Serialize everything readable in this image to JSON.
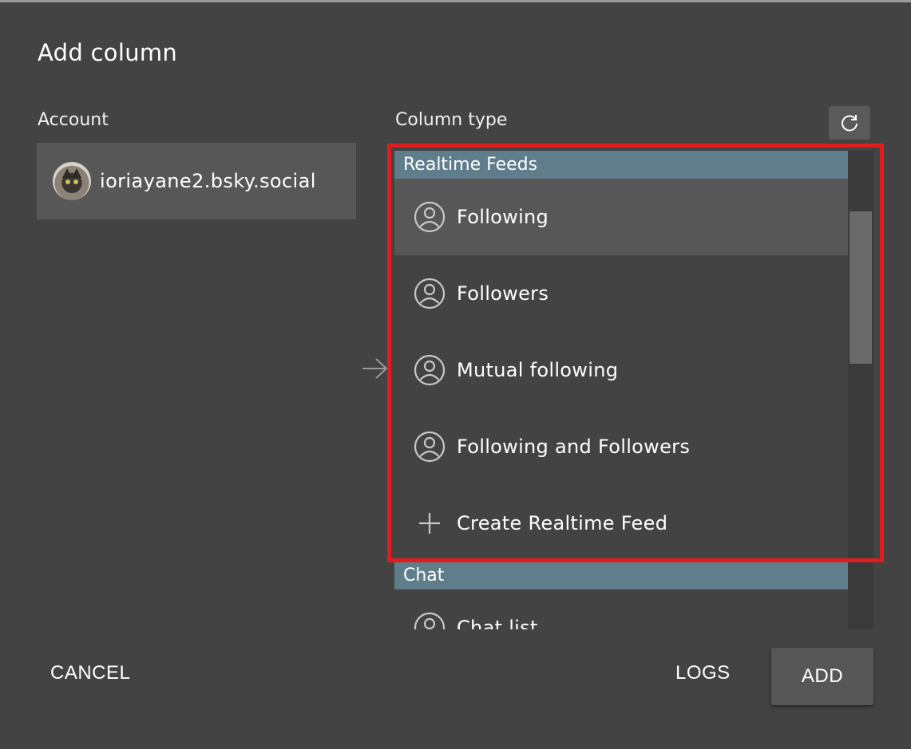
{
  "dialog": {
    "title": "Add column",
    "account_label": "Account",
    "column_type_label": "Column type"
  },
  "account": {
    "name": "ioriayane2.bsky.social"
  },
  "icons": {
    "refresh": "refresh-icon",
    "arrow": "arrow-right-icon",
    "user": "user-circle-icon",
    "plus": "plus-icon"
  },
  "column_types": {
    "groups": [
      {
        "header": "Realtime Feeds",
        "items": [
          {
            "label": "Following",
            "icon": "user-circle-icon",
            "selected": true
          },
          {
            "label": "Followers",
            "icon": "user-circle-icon"
          },
          {
            "label": "Mutual following",
            "icon": "user-circle-icon"
          },
          {
            "label": "Following and Followers",
            "icon": "user-circle-icon"
          },
          {
            "label": "Create Realtime Feed",
            "icon": "plus-icon"
          }
        ]
      },
      {
        "header": "Chat",
        "items": [
          {
            "label": "Chat list",
            "icon": "user-circle-icon"
          }
        ]
      }
    ]
  },
  "footer": {
    "cancel_label": "CANCEL",
    "logs_label": "LOGS",
    "add_label": "ADD"
  },
  "colors": {
    "background": "#434343",
    "group_header": "#5f7d8a",
    "selected_row": "#575757",
    "highlight": "#e11c1c"
  }
}
